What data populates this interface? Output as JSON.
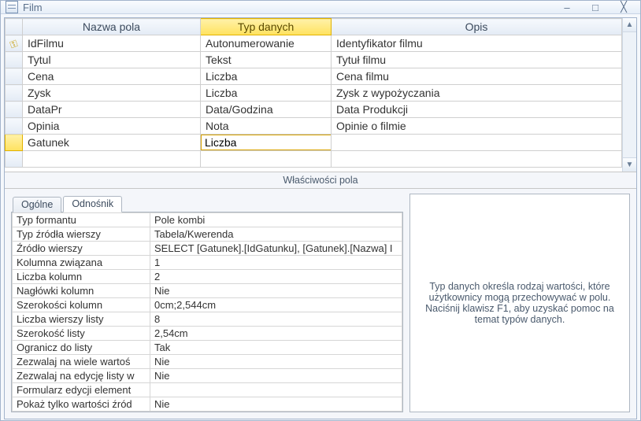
{
  "window": {
    "title": "Film"
  },
  "grid": {
    "headers": {
      "name": "Nazwa pola",
      "type": "Typ danych",
      "desc": "Opis"
    },
    "rows": [
      {
        "pk": true,
        "name": "IdFilmu",
        "type": "Autonumerowanie",
        "desc": "Identyfikator filmu"
      },
      {
        "pk": false,
        "name": "Tytul",
        "type": "Tekst",
        "desc": "Tytuł filmu"
      },
      {
        "pk": false,
        "name": "Cena",
        "type": "Liczba",
        "desc": "Cena filmu"
      },
      {
        "pk": false,
        "name": "Zysk",
        "type": "Liczba",
        "desc": "Zysk z wypożyczania"
      },
      {
        "pk": false,
        "name": "DataPr",
        "type": "Data/Godzina",
        "desc": "Data Produkcji"
      },
      {
        "pk": false,
        "name": "Opinia",
        "type": "Nota",
        "desc": "Opinie o filmie"
      },
      {
        "pk": false,
        "name": "Gatunek",
        "type": "Liczba",
        "desc": "",
        "active": true
      }
    ]
  },
  "props_title": "Właściwości pola",
  "tabs": {
    "general": "Ogólne",
    "lookup": "Odnośnik"
  },
  "props": [
    {
      "label": "Typ formantu",
      "value": "Pole kombi"
    },
    {
      "label": "Typ źródła wierszy",
      "value": "Tabela/Kwerenda"
    },
    {
      "label": "Źródło wierszy",
      "value": "SELECT [Gatunek].[IdGatunku], [Gatunek].[Nazwa] I"
    },
    {
      "label": "Kolumna związana",
      "value": "1"
    },
    {
      "label": "Liczba kolumn",
      "value": "2"
    },
    {
      "label": "Nagłówki kolumn",
      "value": "Nie"
    },
    {
      "label": "Szerokości kolumn",
      "value": "0cm;2,544cm"
    },
    {
      "label": "Liczba wierszy listy",
      "value": "8"
    },
    {
      "label": "Szerokość listy",
      "value": "2,54cm"
    },
    {
      "label": "Ogranicz do listy",
      "value": "Tak"
    },
    {
      "label": "Zezwalaj na wiele wartoś",
      "value": "Nie"
    },
    {
      "label": "Zezwalaj na edycję listy w",
      "value": "Nie"
    },
    {
      "label": "Formularz edycji element",
      "value": ""
    },
    {
      "label": "Pokaż tylko wartości źród",
      "value": "Nie"
    }
  ],
  "help_text": "Typ danych określa rodzaj wartości, które użytkownicy mogą przechowywać w polu. Naciśnij klawisz F1, aby uzyskać pomoc na temat typów danych."
}
